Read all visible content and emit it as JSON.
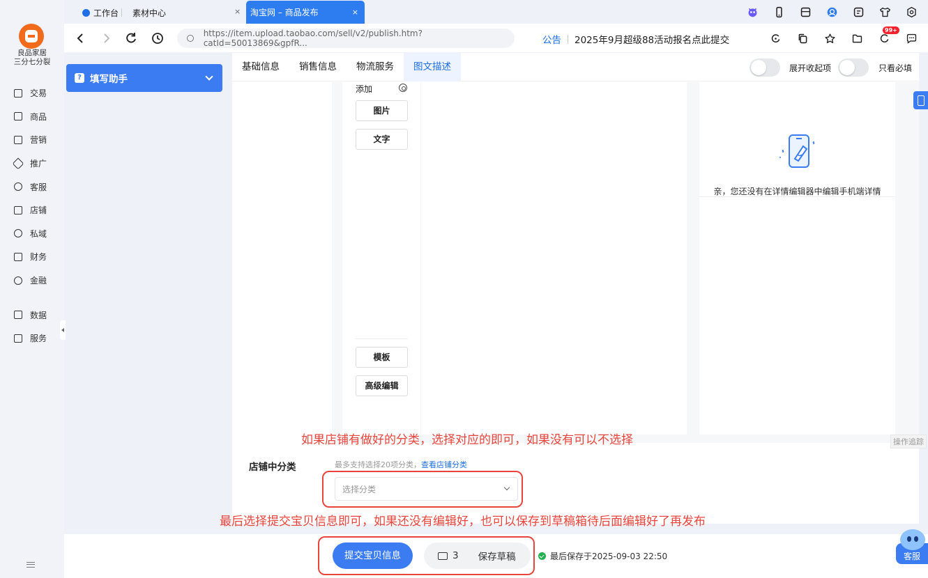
{
  "sidebar": {
    "shop_name_line1": "良品家居",
    "shop_name_line2": "三分七分裂",
    "items": [
      {
        "label": "交易",
        "icon": "receipt-icon"
      },
      {
        "label": "商品",
        "icon": "bag-icon"
      },
      {
        "label": "营销",
        "icon": "ticket-icon"
      },
      {
        "label": "推广",
        "icon": "send-icon"
      },
      {
        "label": "客服",
        "icon": "headset-icon"
      },
      {
        "label": "店铺",
        "icon": "store-icon"
      },
      {
        "label": "私域",
        "icon": "users-icon"
      },
      {
        "label": "财务",
        "icon": "yuan-icon"
      },
      {
        "label": "金融",
        "icon": "finance-icon"
      }
    ],
    "items2": [
      {
        "label": "数据",
        "icon": "chart-icon"
      },
      {
        "label": "服务",
        "icon": "calendar-icon"
      }
    ]
  },
  "browser": {
    "tab1": "工作台",
    "tab2": "素材中心",
    "tab2_close": "×",
    "active_tab": "淘宝网 – 商品发布",
    "active_tab_close": "×",
    "url": "https://item.upload.taobao.com/sell/v2/publish.htm?catId=50013869&gpfR...",
    "badge": "99+"
  },
  "notice": {
    "label": "公告",
    "text": "2025年9月超级88活动报名点此提交"
  },
  "helper": {
    "icon_text": "?",
    "title": "填写助手"
  },
  "section_tabs": [
    "基础信息",
    "销售信息",
    "物流服务",
    "图文描述"
  ],
  "switches": {
    "expand_label": "展开收起项",
    "required_label": "只看必填"
  },
  "editor": {
    "add_label": "添加",
    "btn_image": "图片",
    "btn_text": "文字",
    "btn_template": "模板",
    "btn_advanced": "高级编辑",
    "empty_text": "亲，您还没有在详情编辑器中编辑手机端详情"
  },
  "annotations": {
    "note1": "如果店铺有做好的分类，选择对应的即可，如果没有可以不选择",
    "note2": "最后选择提交宝贝信息即可，如果还没有编辑好，也可以保存到草稿箱待后面编辑好了再发布"
  },
  "category": {
    "label": "店铺中分类",
    "hint": "最多支持选择20项分类，",
    "link": "查看店铺分类",
    "placeholder": "选择分类"
  },
  "side": {
    "oplog": "操作追踪"
  },
  "bottom": {
    "submit": "提交宝贝信息",
    "draft_count": "3",
    "save_draft": "保存草稿",
    "last_saved": "最后保存于2025-09-03 22:50"
  },
  "kefu": {
    "label": "客服"
  }
}
